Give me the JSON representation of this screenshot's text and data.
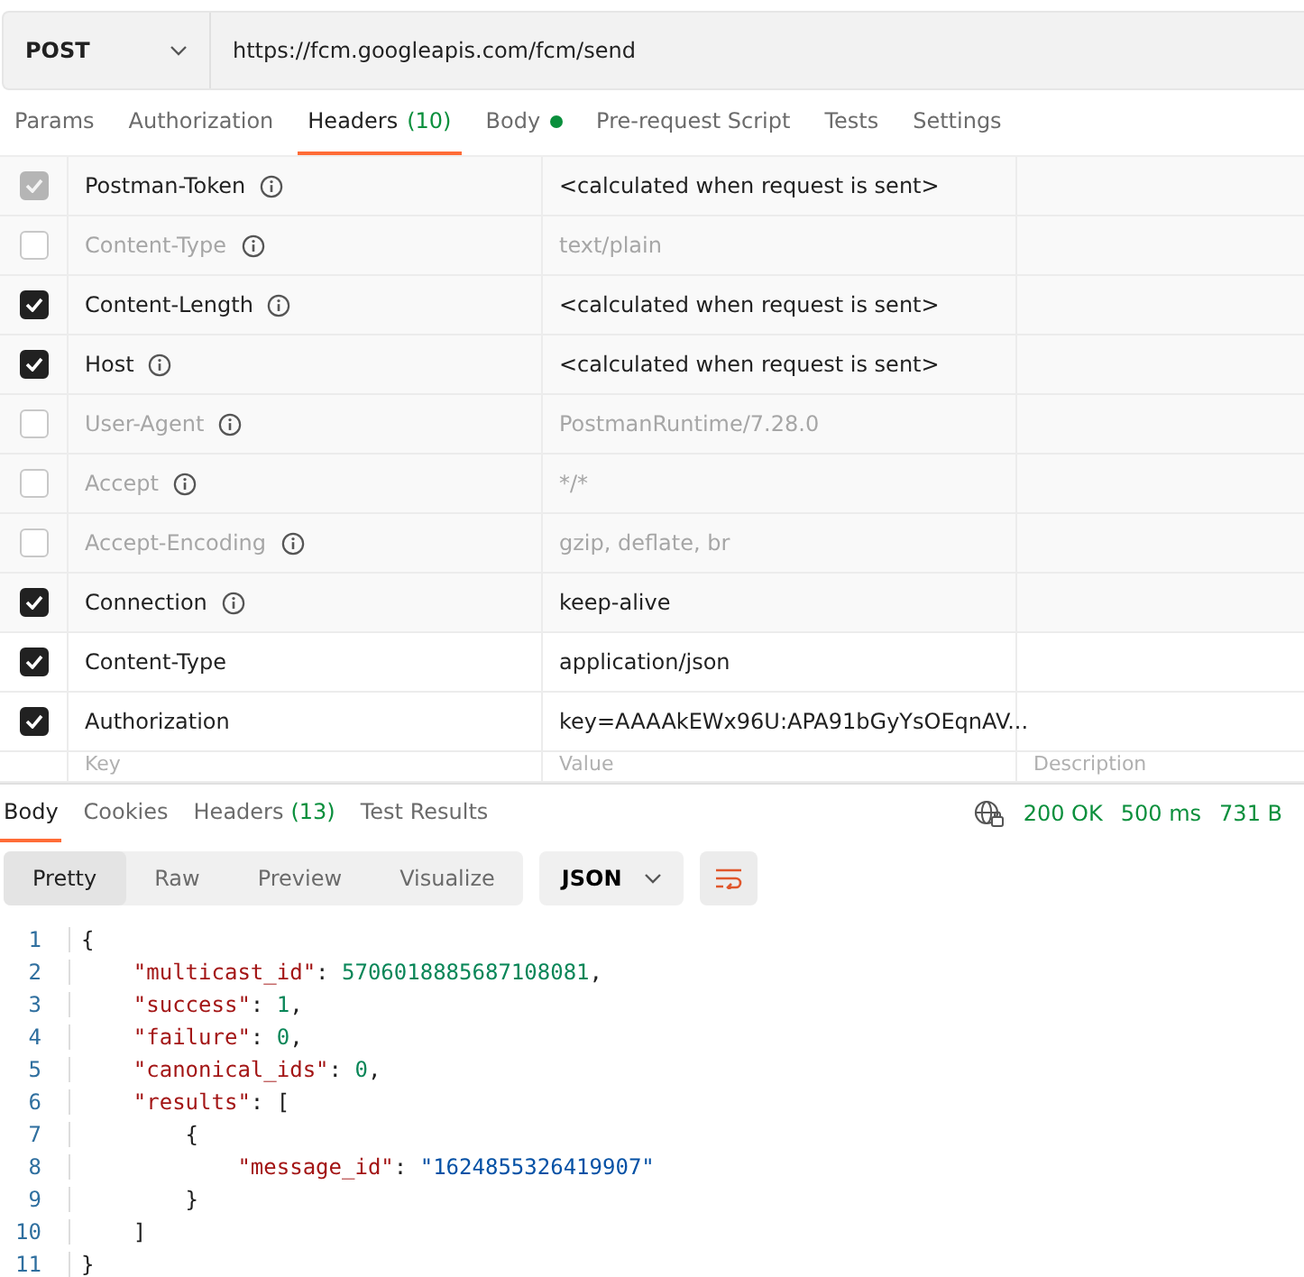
{
  "request": {
    "method": "POST",
    "url": "https://fcm.googleapis.com/fcm/send"
  },
  "request_tabs": [
    {
      "label": "Params",
      "selected": false
    },
    {
      "label": "Authorization",
      "selected": false
    },
    {
      "label": "Headers",
      "count": "(10)",
      "selected": true
    },
    {
      "label": "Body",
      "dot": true,
      "selected": false
    },
    {
      "label": "Pre-request Script",
      "selected": false
    },
    {
      "label": "Tests",
      "selected": false
    },
    {
      "label": "Settings",
      "selected": false
    }
  ],
  "headers": [
    {
      "kind": "auto",
      "checked": true,
      "locked": true,
      "key": "Postman-Token",
      "info": true,
      "value": "<calculated when request is sent>"
    },
    {
      "kind": "auto",
      "checked": false,
      "locked": false,
      "key": "Content-Type",
      "info": true,
      "value": "text/plain"
    },
    {
      "kind": "auto",
      "checked": true,
      "locked": false,
      "key": "Content-Length",
      "info": true,
      "value": "<calculated when request is sent>"
    },
    {
      "kind": "auto",
      "checked": true,
      "locked": false,
      "key": "Host",
      "info": true,
      "value": "<calculated when request is sent>"
    },
    {
      "kind": "auto",
      "checked": false,
      "locked": false,
      "key": "User-Agent",
      "info": true,
      "value": "PostmanRuntime/7.28.0"
    },
    {
      "kind": "auto",
      "checked": false,
      "locked": false,
      "key": "Accept",
      "info": true,
      "value": "*/*"
    },
    {
      "kind": "auto",
      "checked": false,
      "locked": false,
      "key": "Accept-Encoding",
      "info": true,
      "value": "gzip, deflate, br"
    },
    {
      "kind": "auto",
      "checked": true,
      "locked": false,
      "key": "Connection",
      "info": true,
      "value": "keep-alive"
    },
    {
      "kind": "custom",
      "checked": true,
      "locked": false,
      "key": "Content-Type",
      "info": false,
      "value": "application/json"
    },
    {
      "kind": "custom",
      "checked": true,
      "locked": false,
      "key": "Authorization",
      "info": false,
      "value": "key=AAAAkEWx96U:APA91bGyYsOEqnAV..."
    }
  ],
  "new_header": {
    "key_placeholder": "Key",
    "value_placeholder": "Value",
    "description_placeholder": "Description"
  },
  "response_tabs": [
    {
      "label": "Body",
      "selected": true
    },
    {
      "label": "Cookies",
      "selected": false
    },
    {
      "label": "Headers",
      "count": "(13)",
      "selected": false
    },
    {
      "label": "Test Results",
      "selected": false
    }
  ],
  "status": {
    "code": "200 OK",
    "time": "500 ms",
    "size": "731 B"
  },
  "view_modes": [
    {
      "label": "Pretty",
      "selected": true
    },
    {
      "label": "Raw",
      "selected": false
    },
    {
      "label": "Preview",
      "selected": false
    },
    {
      "label": "Visualize",
      "selected": false
    }
  ],
  "format": "JSON",
  "code_lines": [
    {
      "number": "1",
      "tokens": [
        {
          "kind": "punct",
          "text": "{"
        }
      ]
    },
    {
      "number": "2",
      "tokens": [
        {
          "kind": "key",
          "text": "    \"multicast_id\""
        },
        {
          "kind": "punct",
          "text": ": "
        },
        {
          "kind": "number",
          "text": "5706018885687108081"
        },
        {
          "kind": "punct",
          "text": ","
        }
      ]
    },
    {
      "number": "3",
      "tokens": [
        {
          "kind": "key",
          "text": "    \"success\""
        },
        {
          "kind": "punct",
          "text": ": "
        },
        {
          "kind": "number",
          "text": "1"
        },
        {
          "kind": "punct",
          "text": ","
        }
      ]
    },
    {
      "number": "4",
      "tokens": [
        {
          "kind": "key",
          "text": "    \"failure\""
        },
        {
          "kind": "punct",
          "text": ": "
        },
        {
          "kind": "number",
          "text": "0"
        },
        {
          "kind": "punct",
          "text": ","
        }
      ]
    },
    {
      "number": "5",
      "tokens": [
        {
          "kind": "key",
          "text": "    \"canonical_ids\""
        },
        {
          "kind": "punct",
          "text": ": "
        },
        {
          "kind": "number",
          "text": "0"
        },
        {
          "kind": "punct",
          "text": ","
        }
      ]
    },
    {
      "number": "6",
      "tokens": [
        {
          "kind": "key",
          "text": "    \"results\""
        },
        {
          "kind": "punct",
          "text": ": ["
        }
      ]
    },
    {
      "number": "7",
      "tokens": [
        {
          "kind": "punct",
          "text": "        {"
        }
      ]
    },
    {
      "number": "8",
      "tokens": [
        {
          "kind": "key",
          "text": "            \"message_id\""
        },
        {
          "kind": "punct",
          "text": ": "
        },
        {
          "kind": "string",
          "text": "\"1624855326419907\""
        }
      ]
    },
    {
      "number": "9",
      "tokens": [
        {
          "kind": "punct",
          "text": "        }"
        }
      ]
    },
    {
      "number": "10",
      "tokens": [
        {
          "kind": "punct",
          "text": "    ]"
        }
      ]
    },
    {
      "number": "11",
      "tokens": [
        {
          "kind": "punct",
          "text": "}"
        }
      ]
    }
  ]
}
